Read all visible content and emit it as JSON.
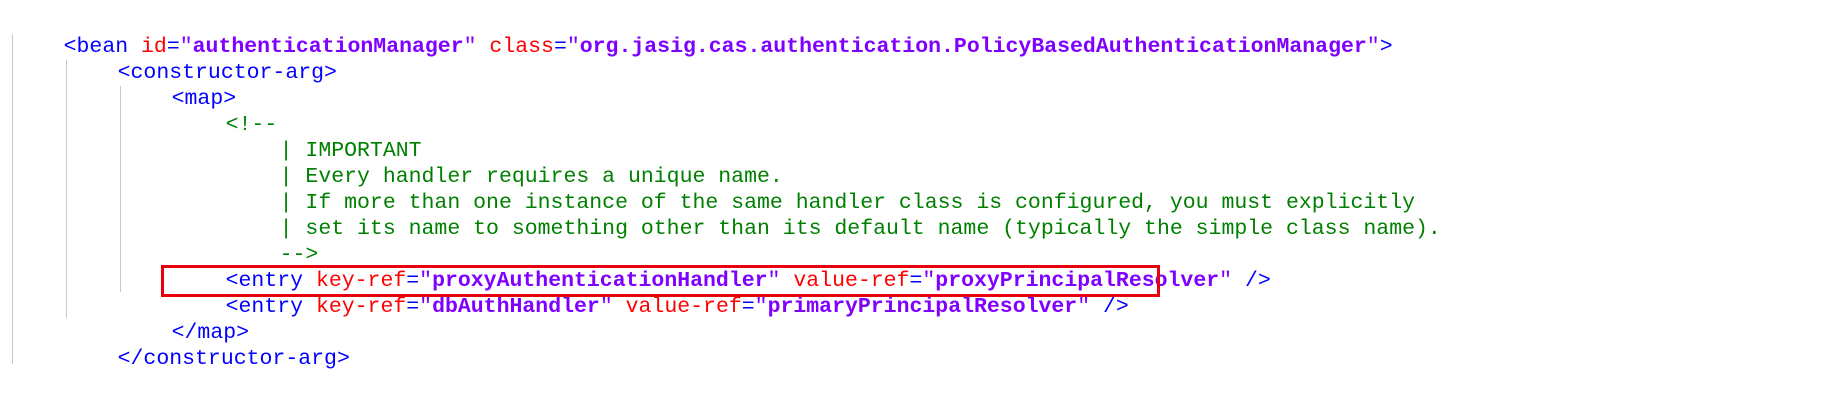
{
  "code": {
    "line1": {
      "open": "<bean",
      "attr1": "id",
      "value1": "authenticationManager",
      "attr2": "class",
      "value2": "org.jasig.cas.authentication.PolicyBasedAuthenticationManager",
      "close": ">"
    },
    "line2": {
      "tag": "<constructor-arg>"
    },
    "line3": {
      "tag": "<map>"
    },
    "line4": {
      "comment_open": "<!--"
    },
    "comment_lines": [
      "| IMPORTANT",
      "| Every handler requires a unique name.",
      "| If more than one instance of the same handler class is configured, you must explicitly",
      "| set its name to something other than its default name (typically the simple class name)."
    ],
    "line9": {
      "comment_close": "-->"
    },
    "entry1": {
      "open": "<entry",
      "attr1": "key-ref",
      "value1": "proxyAuthenticationHandler",
      "attr2": "value-ref",
      "value2": "proxyPrincipalResolver",
      "close": "/>"
    },
    "entry2": {
      "open": "<entry",
      "attr1": "key-ref",
      "value1": "dbAuthHandler",
      "attr2": "value-ref",
      "value2": "primaryPrincipalResolver",
      "close": "/>"
    },
    "line12": {
      "tag": "</map>"
    },
    "line13": {
      "tag": "</constructor-arg>"
    }
  },
  "colors": {
    "tag_bracket": "#0000ff",
    "attribute": "#ff0000",
    "attribute_value": "#8000ff",
    "comment": "#008000",
    "highlight": "#e8000d",
    "indent_guide": "#c8c8c8"
  }
}
